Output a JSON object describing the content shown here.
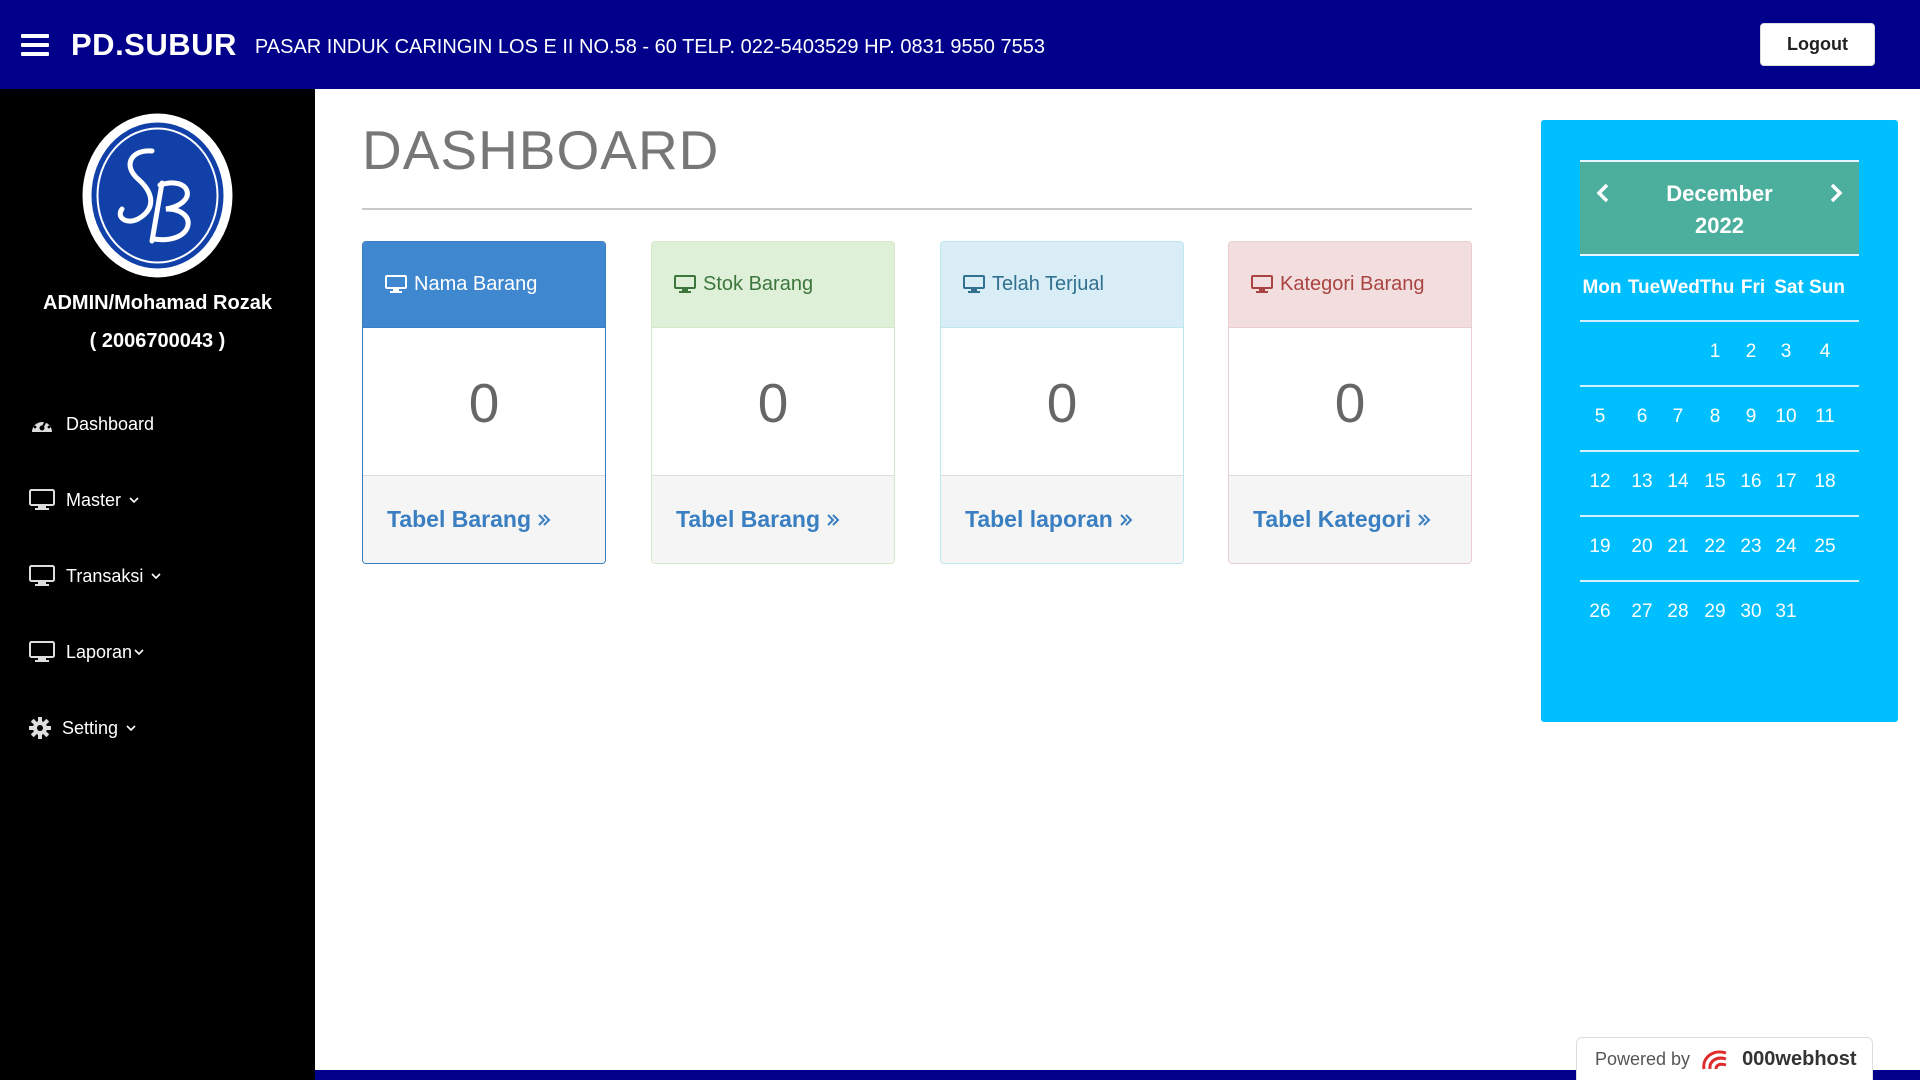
{
  "header": {
    "brand": "PD.SUBUR",
    "address": "PASAR INDUK CARINGIN LOS E II NO.58 - 60 TELP. 022-5403529 HP. 0831 9550 7553",
    "logout_label": "Logout",
    "bar_color": "#00008b"
  },
  "sidebar": {
    "logo_text": "SB",
    "user_name": "ADMIN/Mohamad Rozak",
    "user_id": "( 2006700043 )",
    "items": [
      {
        "label": "Dashboard",
        "icon": "dashboard-icon"
      },
      {
        "label": "Master",
        "icon": "monitor-icon"
      },
      {
        "label": "Transaksi",
        "icon": "monitor-icon"
      },
      {
        "label": "Laporan",
        "icon": "monitor-icon"
      },
      {
        "label": "Setting",
        "icon": "gear-icon"
      }
    ]
  },
  "main": {
    "title": "DASHBOARD",
    "cards": [
      {
        "heading": "Nama Barang",
        "value": "0",
        "link": "Tabel Barang",
        "color": "#3f88cf"
      },
      {
        "heading": "Stok Barang",
        "value": "0",
        "link": "Tabel Barang",
        "color": "#dff0d8"
      },
      {
        "heading": "Telah Terjual",
        "value": "0",
        "link": "Tabel laporan",
        "color": "#d9edf7"
      },
      {
        "heading": "Kategori Barang",
        "value": "0",
        "link": "Tabel Kategori",
        "color": "#f2dede"
      }
    ]
  },
  "calendar": {
    "month": "December",
    "year": "2022",
    "weekdays": [
      "Mon",
      "Tue",
      "Wed",
      "Thu",
      "Fri",
      "Sat",
      "Sun"
    ],
    "weeks": [
      [
        "",
        "",
        "",
        "1",
        "2",
        "3",
        "4"
      ],
      [
        "5",
        "6",
        "7",
        "8",
        "9",
        "10",
        "11"
      ],
      [
        "12",
        "13",
        "14",
        "15",
        "16",
        "17",
        "18"
      ],
      [
        "19",
        "20",
        "21",
        "22",
        "23",
        "24",
        "25"
      ],
      [
        "26",
        "27",
        "28",
        "29",
        "30",
        "31",
        ""
      ]
    ],
    "background": "#00bfff",
    "header_color": "#4cae9c"
  },
  "footer": {
    "powered_by": "Powered by",
    "host": "000webhost"
  }
}
